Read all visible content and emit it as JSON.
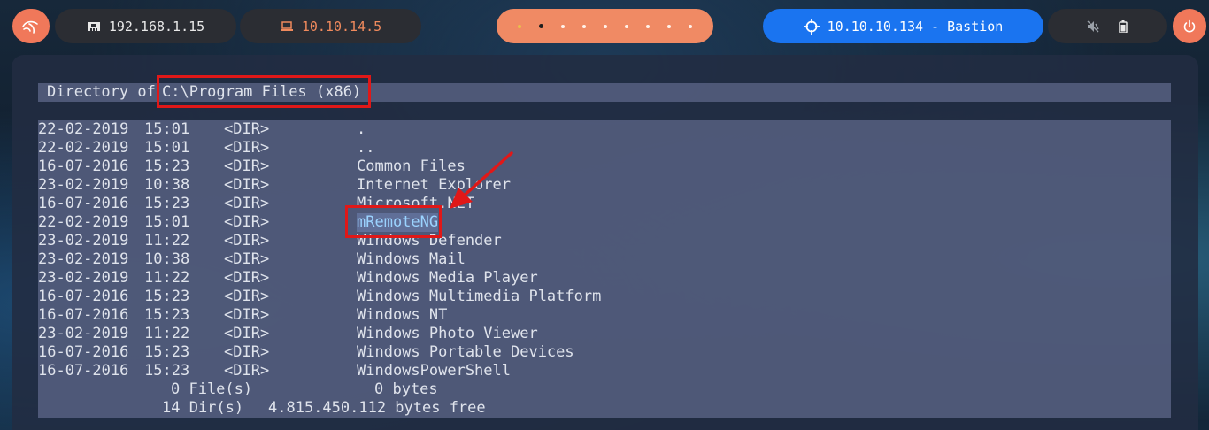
{
  "topbar": {
    "host_ip": "192.168.1.15",
    "vpn_ip": "10.10.14.5",
    "target": "10.10.10.134 - Bastion",
    "workspace_count": 9
  },
  "terminal": {
    "header_prefix": "Directory of ",
    "header_path": "C:\\Program Files (x86)",
    "rows": [
      {
        "date": "22-02-2019",
        "time": "15:01",
        "type": "<DIR>",
        "name": "."
      },
      {
        "date": "22-02-2019",
        "time": "15:01",
        "type": "<DIR>",
        "name": ".."
      },
      {
        "date": "16-07-2016",
        "time": "15:23",
        "type": "<DIR>",
        "name": "Common Files"
      },
      {
        "date": "23-02-2019",
        "time": "10:38",
        "type": "<DIR>",
        "name": "Internet Explorer"
      },
      {
        "date": "16-07-2016",
        "time": "15:23",
        "type": "<DIR>",
        "name": "Microsoft.NET"
      },
      {
        "date": "22-02-2019",
        "time": "15:01",
        "type": "<DIR>",
        "name": "mRemoteNG"
      },
      {
        "date": "23-02-2019",
        "time": "11:22",
        "type": "<DIR>",
        "name": "Windows Defender"
      },
      {
        "date": "23-02-2019",
        "time": "10:38",
        "type": "<DIR>",
        "name": "Windows Mail"
      },
      {
        "date": "23-02-2019",
        "time": "11:22",
        "type": "<DIR>",
        "name": "Windows Media Player"
      },
      {
        "date": "16-07-2016",
        "time": "15:23",
        "type": "<DIR>",
        "name": "Windows Multimedia Platform"
      },
      {
        "date": "16-07-2016",
        "time": "15:23",
        "type": "<DIR>",
        "name": "Windows NT"
      },
      {
        "date": "23-02-2019",
        "time": "11:22",
        "type": "<DIR>",
        "name": "Windows Photo Viewer"
      },
      {
        "date": "16-07-2016",
        "time": "15:23",
        "type": "<DIR>",
        "name": "Windows Portable Devices"
      },
      {
        "date": "16-07-2016",
        "time": "15:23",
        "type": "<DIR>",
        "name": "WindowsPowerShell"
      }
    ],
    "summary_files": "0 File(s)",
    "summary_files_bytes": "0 bytes",
    "summary_dirs": "14 Dir(s)",
    "summary_dirs_free": "4.815.450.112 bytes free"
  },
  "colors": {
    "accent_orange": "#f0785a",
    "target_blue": "#1a74f0",
    "annotation_red": "#e01818"
  }
}
